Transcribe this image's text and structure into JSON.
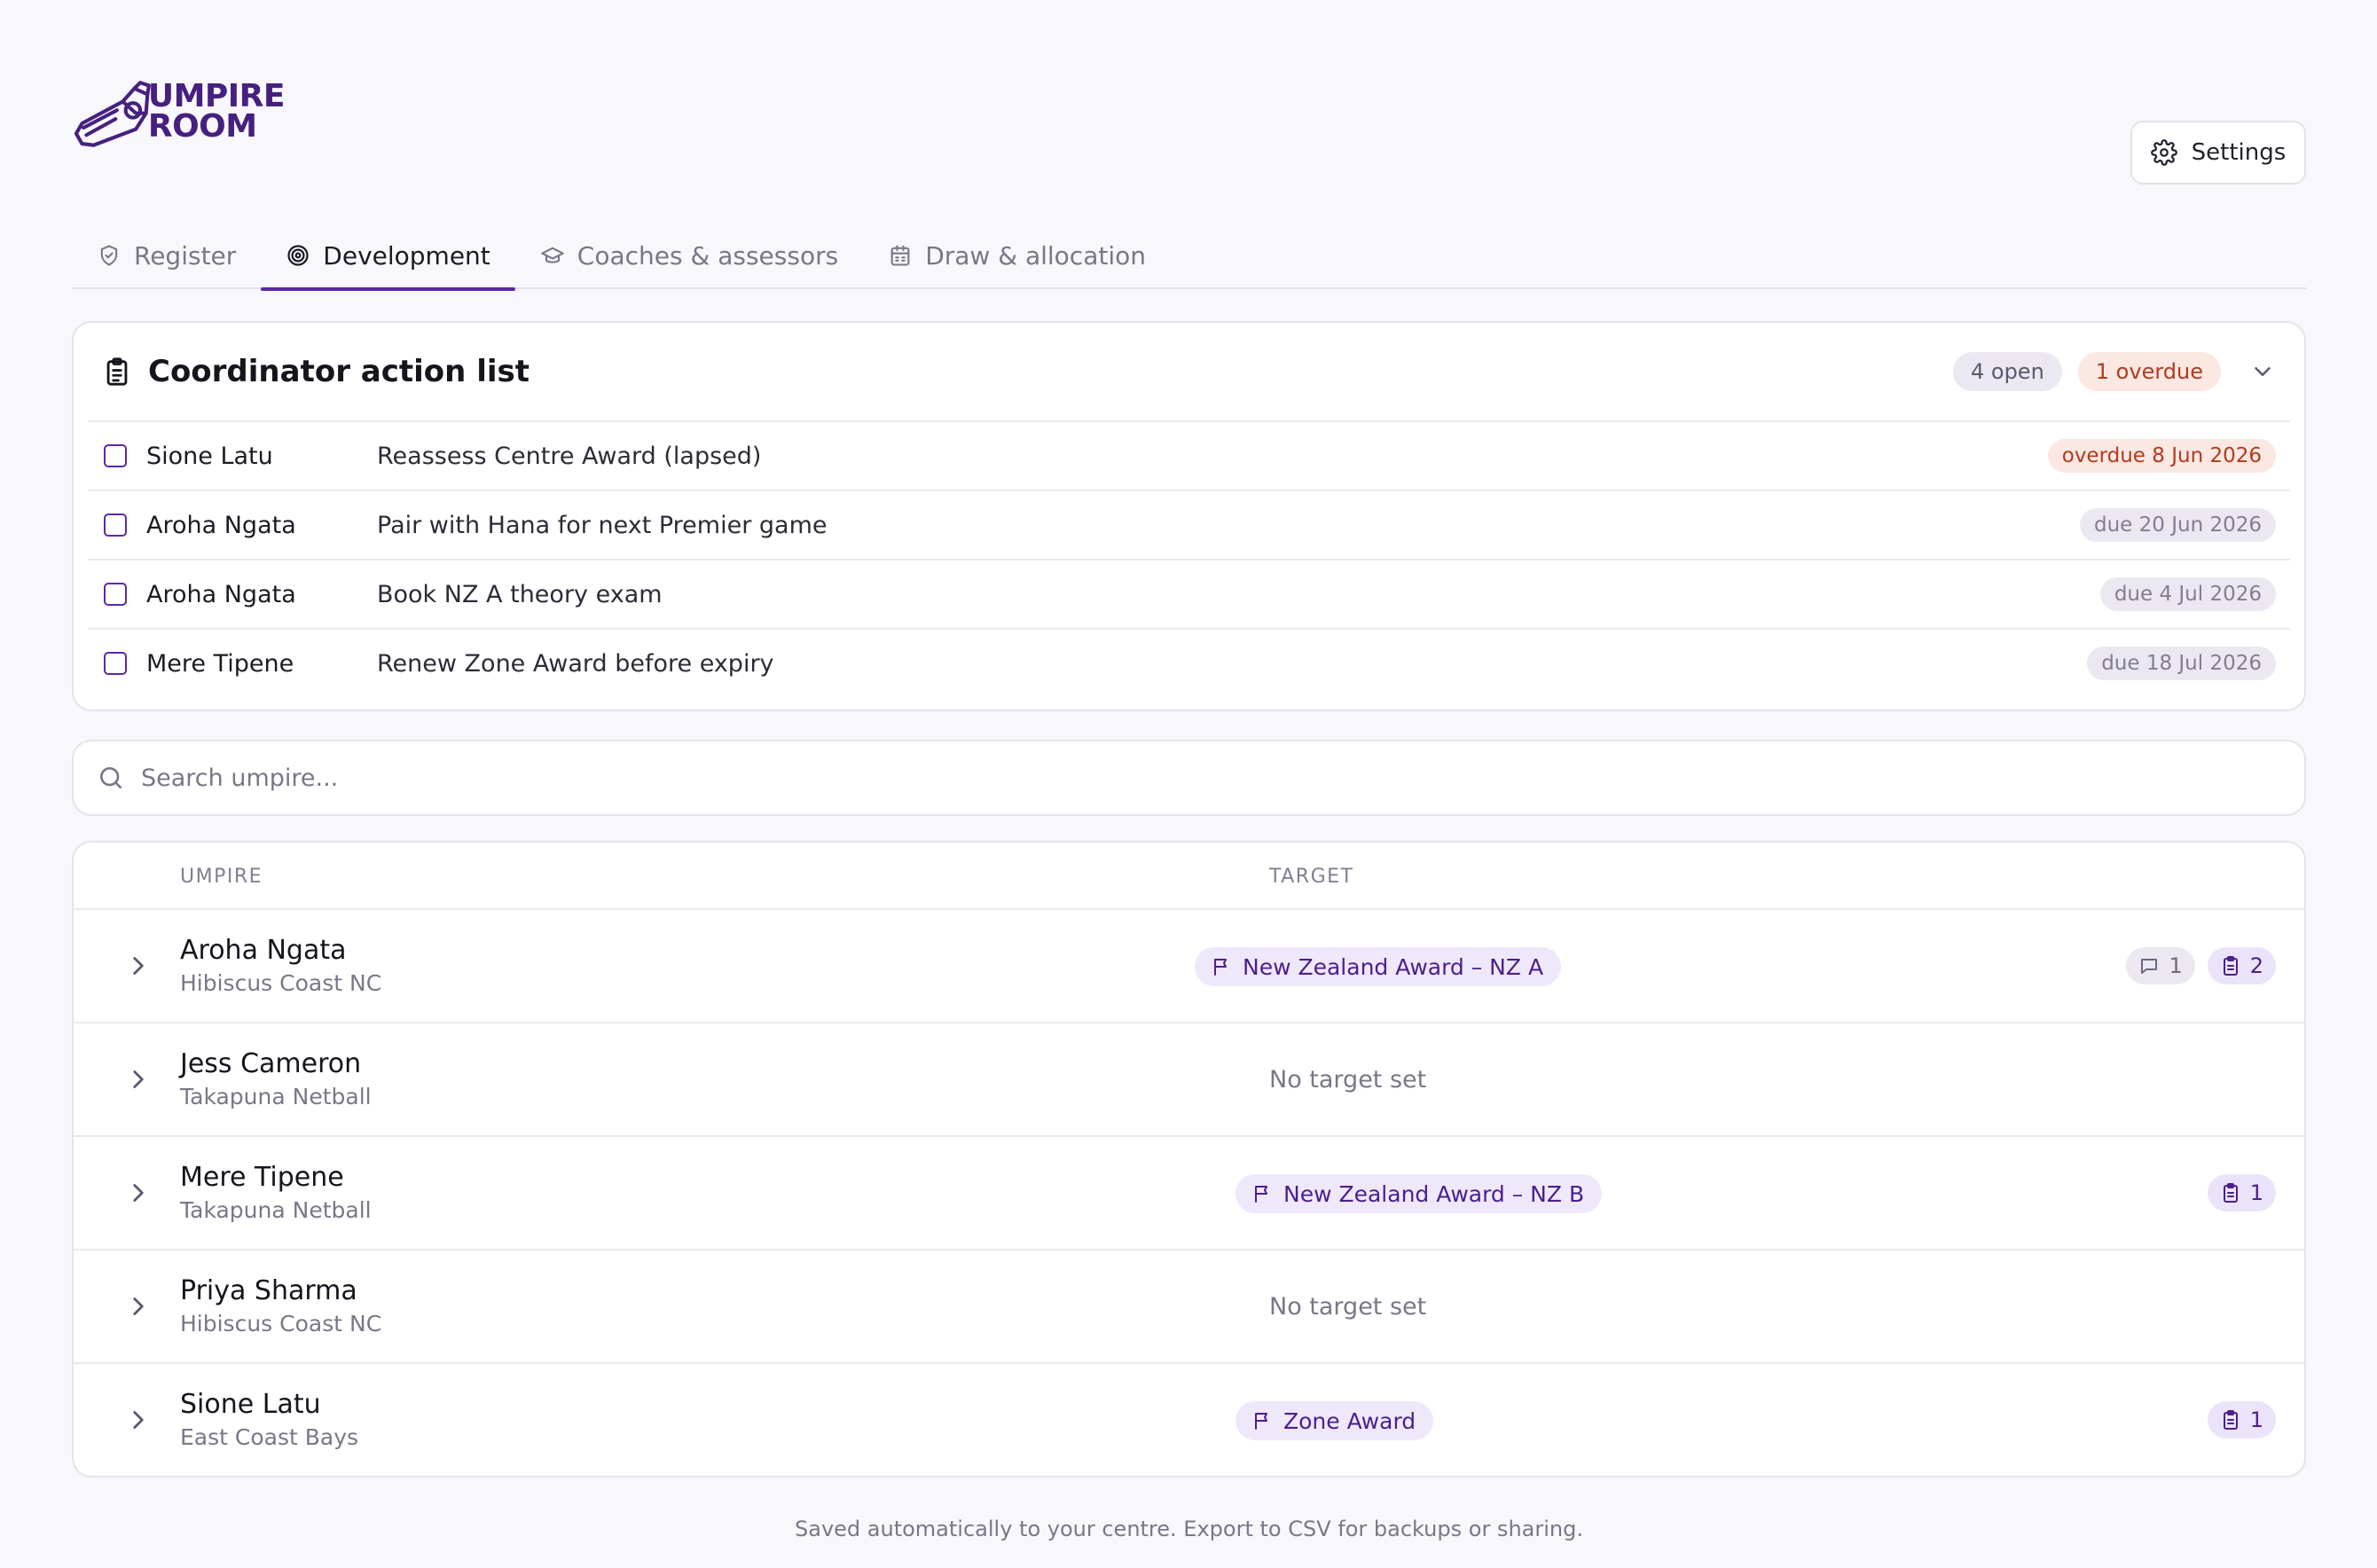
{
  "brand": {
    "line1": "UMPIRE",
    "line2": "ROOM",
    "logo_icon": "whistle-icon",
    "color": "#46207f"
  },
  "header": {
    "settings_label": "Settings",
    "settings_icon": "gear-icon"
  },
  "tabs": [
    {
      "label": "Register",
      "icon": "shield-check-icon",
      "active": false
    },
    {
      "label": "Development",
      "icon": "target-icon",
      "active": true
    },
    {
      "label": "Coaches & assessors",
      "icon": "graduation-cap-icon",
      "active": false
    },
    {
      "label": "Draw & allocation",
      "icon": "calendar-icon",
      "active": false
    }
  ],
  "action_list": {
    "title": "Coordinator action list",
    "open_badge": "4 open",
    "overdue_badge": "1 overdue",
    "items": [
      {
        "name": "Sione Latu",
        "task": "Reassess Centre Award (lapsed)",
        "due": "overdue 8 Jun 2026",
        "status": "overdue"
      },
      {
        "name": "Aroha Ngata",
        "task": "Pair with Hana for next Premier game",
        "due": "due 20 Jun 2026",
        "status": "due"
      },
      {
        "name": "Aroha Ngata",
        "task": "Book NZ A theory exam",
        "due": "due 4 Jul 2026",
        "status": "due"
      },
      {
        "name": "Mere Tipene",
        "task": "Renew Zone Award before expiry",
        "due": "due 18 Jul 2026",
        "status": "due"
      }
    ]
  },
  "search": {
    "placeholder": "Search umpire..."
  },
  "table": {
    "col_umpire": "UMPIRE",
    "col_target": "TARGET",
    "rows": [
      {
        "name": "Aroha Ngata",
        "club": "Hibiscus Coast NC",
        "target": "New Zealand Award – NZ A",
        "notes": "1",
        "tasks": "2"
      },
      {
        "name": "Jess Cameron",
        "club": "Takapuna Netball",
        "target": "No target set"
      },
      {
        "name": "Mere Tipene",
        "club": "Takapuna Netball",
        "target": "New Zealand Award – NZ B",
        "tasks": "1"
      },
      {
        "name": "Priya Sharma",
        "club": "Hibiscus Coast NC",
        "target": "No target set"
      },
      {
        "name": "Sione Latu",
        "club": "East Coast Bays",
        "target": "Zone Award",
        "tasks": "1"
      }
    ]
  },
  "footer": "Saved automatically to your centre. Export to CSV for backups or sharing.",
  "colors": {
    "accent": "#5a2aa3",
    "overdue": "#b23a1e",
    "pill_bg": "#efe8fb"
  }
}
